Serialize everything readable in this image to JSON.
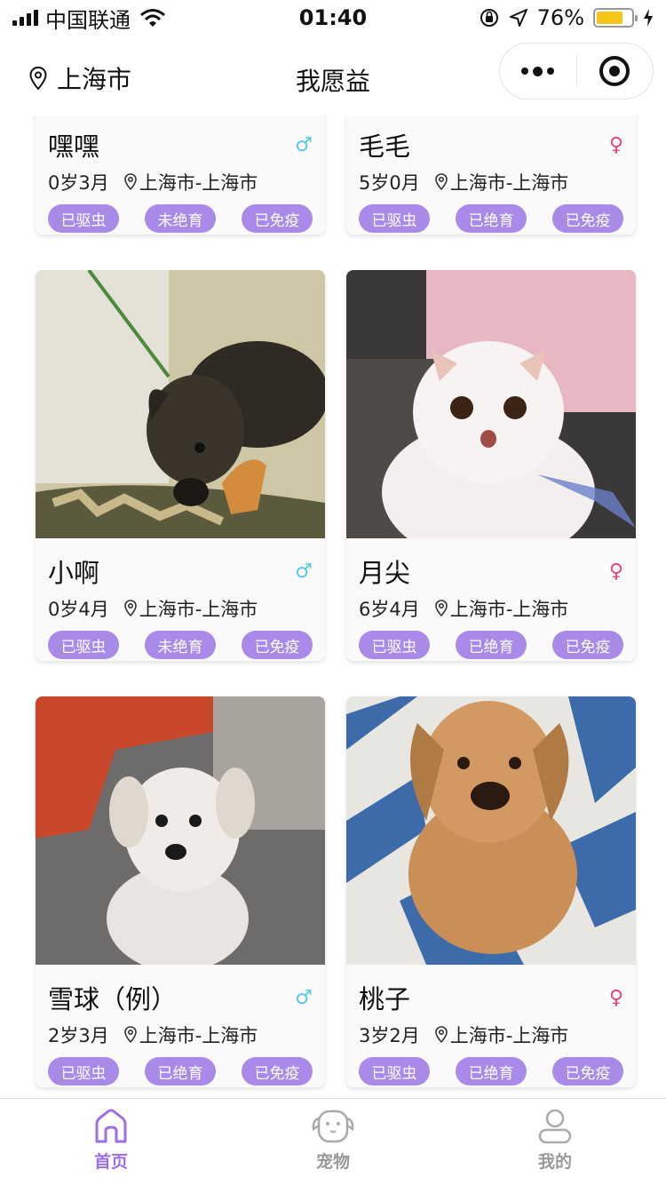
{
  "status_bar": {
    "carrier": "中国联通",
    "time": "01:40",
    "battery": "76%",
    "battery_level": 0.76
  },
  "nav": {
    "location": "上海市",
    "title": "我愿益"
  },
  "colors": {
    "tag_bg": "#a98ae8",
    "accent": "#9a6ee6",
    "male": "#5ac8e8",
    "female": "#e5467a"
  },
  "pets": [
    {
      "name": "嘿嘿",
      "gender": "♂",
      "age": "0岁3月",
      "location": "上海市-上海市",
      "tags": [
        "已驱虫",
        "未绝育",
        "已免疫"
      ]
    },
    {
      "name": "毛毛",
      "gender": "♀",
      "age": "5岁0月",
      "location": "上海市-上海市",
      "tags": [
        "已驱虫",
        "已绝育",
        "已免疫"
      ]
    },
    {
      "name": "小啊",
      "gender": "♂",
      "age": "0岁4月",
      "location": "上海市-上海市",
      "tags": [
        "已驱虫",
        "未绝育",
        "已免疫"
      ]
    },
    {
      "name": "月尖",
      "gender": "♀",
      "age": "6岁4月",
      "location": "上海市-上海市",
      "tags": [
        "已驱虫",
        "已绝育",
        "已免疫"
      ]
    },
    {
      "name": "雪球（例）",
      "gender": "♂",
      "age": "2岁3月",
      "location": "上海市-上海市",
      "tags": [
        "已驱虫",
        "已绝育",
        "已免疫"
      ]
    },
    {
      "name": "桃子",
      "gender": "♀",
      "age": "3岁2月",
      "location": "上海市-上海市",
      "tags": [
        "已驱虫",
        "已绝育",
        "已免疫"
      ]
    }
  ],
  "tabs": [
    {
      "label": "首页",
      "icon": "home-icon"
    },
    {
      "label": "宠物",
      "icon": "pet-icon"
    },
    {
      "label": "我的",
      "icon": "profile-icon"
    }
  ]
}
